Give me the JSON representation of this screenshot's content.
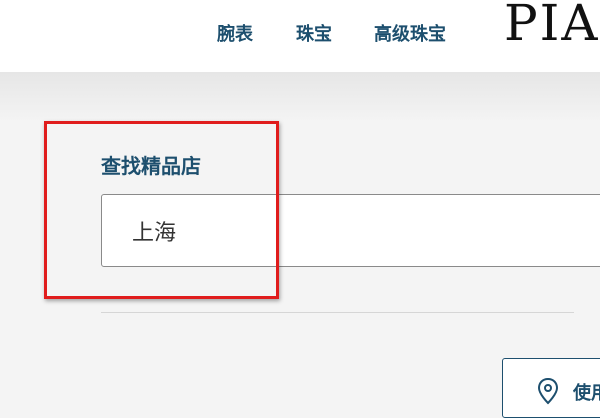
{
  "nav": {
    "items": [
      {
        "label": "腕表"
      },
      {
        "label": "珠宝"
      },
      {
        "label": "高级珠宝"
      }
    ]
  },
  "logo": {
    "text": "PIA"
  },
  "store_finder": {
    "title": "查找精品店",
    "search_value": "上海",
    "locate_button_label": "使用"
  },
  "colors": {
    "brand": "#1d4f6e",
    "highlight": "#e01c1c",
    "background": "#f4f4f4"
  }
}
